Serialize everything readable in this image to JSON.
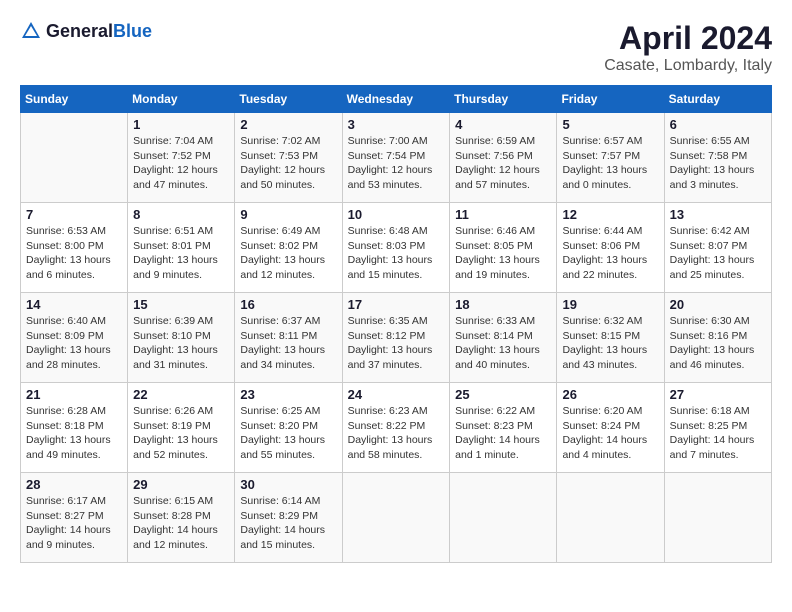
{
  "header": {
    "logo_general": "General",
    "logo_blue": "Blue",
    "month_title": "April 2024",
    "location": "Casate, Lombardy, Italy"
  },
  "calendar": {
    "days_of_week": [
      "Sunday",
      "Monday",
      "Tuesday",
      "Wednesday",
      "Thursday",
      "Friday",
      "Saturday"
    ],
    "weeks": [
      [
        {
          "day": "",
          "info": ""
        },
        {
          "day": "1",
          "info": "Sunrise: 7:04 AM\nSunset: 7:52 PM\nDaylight: 12 hours\nand 47 minutes."
        },
        {
          "day": "2",
          "info": "Sunrise: 7:02 AM\nSunset: 7:53 PM\nDaylight: 12 hours\nand 50 minutes."
        },
        {
          "day": "3",
          "info": "Sunrise: 7:00 AM\nSunset: 7:54 PM\nDaylight: 12 hours\nand 53 minutes."
        },
        {
          "day": "4",
          "info": "Sunrise: 6:59 AM\nSunset: 7:56 PM\nDaylight: 12 hours\nand 57 minutes."
        },
        {
          "day": "5",
          "info": "Sunrise: 6:57 AM\nSunset: 7:57 PM\nDaylight: 13 hours\nand 0 minutes."
        },
        {
          "day": "6",
          "info": "Sunrise: 6:55 AM\nSunset: 7:58 PM\nDaylight: 13 hours\nand 3 minutes."
        }
      ],
      [
        {
          "day": "7",
          "info": "Sunrise: 6:53 AM\nSunset: 8:00 PM\nDaylight: 13 hours\nand 6 minutes."
        },
        {
          "day": "8",
          "info": "Sunrise: 6:51 AM\nSunset: 8:01 PM\nDaylight: 13 hours\nand 9 minutes."
        },
        {
          "day": "9",
          "info": "Sunrise: 6:49 AM\nSunset: 8:02 PM\nDaylight: 13 hours\nand 12 minutes."
        },
        {
          "day": "10",
          "info": "Sunrise: 6:48 AM\nSunset: 8:03 PM\nDaylight: 13 hours\nand 15 minutes."
        },
        {
          "day": "11",
          "info": "Sunrise: 6:46 AM\nSunset: 8:05 PM\nDaylight: 13 hours\nand 19 minutes."
        },
        {
          "day": "12",
          "info": "Sunrise: 6:44 AM\nSunset: 8:06 PM\nDaylight: 13 hours\nand 22 minutes."
        },
        {
          "day": "13",
          "info": "Sunrise: 6:42 AM\nSunset: 8:07 PM\nDaylight: 13 hours\nand 25 minutes."
        }
      ],
      [
        {
          "day": "14",
          "info": "Sunrise: 6:40 AM\nSunset: 8:09 PM\nDaylight: 13 hours\nand 28 minutes."
        },
        {
          "day": "15",
          "info": "Sunrise: 6:39 AM\nSunset: 8:10 PM\nDaylight: 13 hours\nand 31 minutes."
        },
        {
          "day": "16",
          "info": "Sunrise: 6:37 AM\nSunset: 8:11 PM\nDaylight: 13 hours\nand 34 minutes."
        },
        {
          "day": "17",
          "info": "Sunrise: 6:35 AM\nSunset: 8:12 PM\nDaylight: 13 hours\nand 37 minutes."
        },
        {
          "day": "18",
          "info": "Sunrise: 6:33 AM\nSunset: 8:14 PM\nDaylight: 13 hours\nand 40 minutes."
        },
        {
          "day": "19",
          "info": "Sunrise: 6:32 AM\nSunset: 8:15 PM\nDaylight: 13 hours\nand 43 minutes."
        },
        {
          "day": "20",
          "info": "Sunrise: 6:30 AM\nSunset: 8:16 PM\nDaylight: 13 hours\nand 46 minutes."
        }
      ],
      [
        {
          "day": "21",
          "info": "Sunrise: 6:28 AM\nSunset: 8:18 PM\nDaylight: 13 hours\nand 49 minutes."
        },
        {
          "day": "22",
          "info": "Sunrise: 6:26 AM\nSunset: 8:19 PM\nDaylight: 13 hours\nand 52 minutes."
        },
        {
          "day": "23",
          "info": "Sunrise: 6:25 AM\nSunset: 8:20 PM\nDaylight: 13 hours\nand 55 minutes."
        },
        {
          "day": "24",
          "info": "Sunrise: 6:23 AM\nSunset: 8:22 PM\nDaylight: 13 hours\nand 58 minutes."
        },
        {
          "day": "25",
          "info": "Sunrise: 6:22 AM\nSunset: 8:23 PM\nDaylight: 14 hours\nand 1 minute."
        },
        {
          "day": "26",
          "info": "Sunrise: 6:20 AM\nSunset: 8:24 PM\nDaylight: 14 hours\nand 4 minutes."
        },
        {
          "day": "27",
          "info": "Sunrise: 6:18 AM\nSunset: 8:25 PM\nDaylight: 14 hours\nand 7 minutes."
        }
      ],
      [
        {
          "day": "28",
          "info": "Sunrise: 6:17 AM\nSunset: 8:27 PM\nDaylight: 14 hours\nand 9 minutes."
        },
        {
          "day": "29",
          "info": "Sunrise: 6:15 AM\nSunset: 8:28 PM\nDaylight: 14 hours\nand 12 minutes."
        },
        {
          "day": "30",
          "info": "Sunrise: 6:14 AM\nSunset: 8:29 PM\nDaylight: 14 hours\nand 15 minutes."
        },
        {
          "day": "",
          "info": ""
        },
        {
          "day": "",
          "info": ""
        },
        {
          "day": "",
          "info": ""
        },
        {
          "day": "",
          "info": ""
        }
      ]
    ]
  }
}
